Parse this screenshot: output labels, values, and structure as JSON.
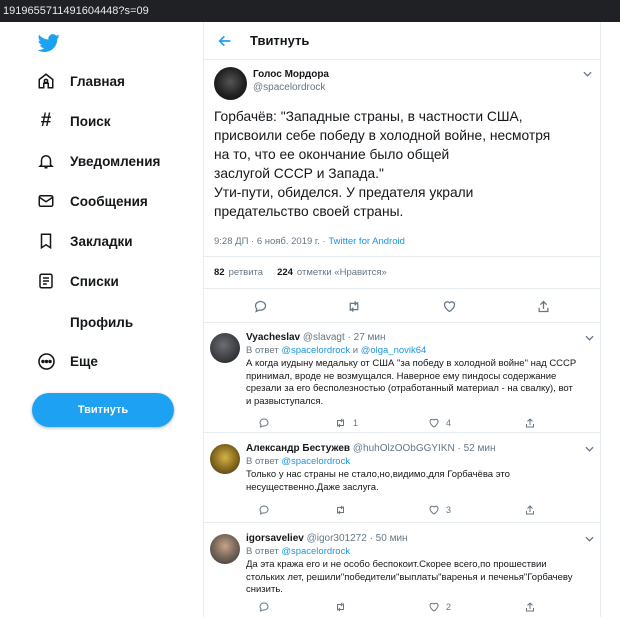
{
  "browser": {
    "url": "1919655711491604448?s=09"
  },
  "sidebar": {
    "items": [
      {
        "label": "Главная",
        "icon": "home-icon"
      },
      {
        "label": "Поиск",
        "icon": "hashtag-icon"
      },
      {
        "label": "Уведомления",
        "icon": "bell-icon"
      },
      {
        "label": "Сообщения",
        "icon": "envelope-icon"
      },
      {
        "label": "Закладки",
        "icon": "bookmark-icon"
      },
      {
        "label": "Списки",
        "icon": "list-icon"
      },
      {
        "label": "Профиль",
        "icon": ""
      },
      {
        "label": "Еще",
        "icon": "more-circle-icon"
      }
    ],
    "tweet_button": "Твитнуть"
  },
  "header": {
    "title": "Твитнуть"
  },
  "tweet": {
    "author": "Голос Мордора",
    "handle": "@spacelordrock",
    "text_lines": [
      "Горбачёв: \"Западные страны, в частности США,",
      "присвоили себе победу в холодной войне, несмотря",
      "на то, что ее окончание было общей",
      "заслугой СССР и Запада.\"",
      "Ути-пути, обиделся. У предателя украли",
      "предательство своей страны."
    ],
    "time": "9:28 ДП · 6 нояб. 2019 г. ·",
    "source": "Twitter for Android",
    "retweets_count": "82",
    "retweets_label": "ретвита",
    "likes_count": "224",
    "likes_label": "отметки «Нравится»"
  },
  "replies": [
    {
      "name": "Vyacheslav",
      "handle": "@slavagt",
      "time": "· 27 мин",
      "reply_prefix": "В ответ",
      "reply_to": "@spacelordrock",
      "reply_and": "и",
      "reply_to2": "@olga_novik64",
      "text_lines": [
        "А когда иудыну медальку от США \"за победу в холодной войне\" над СССР",
        "принимал, вроде не возмущался. Наверное ему пиндосы содержание",
        "срезали за его бесполезностью (отработанный материал - на свалку), вот",
        "и развыступался."
      ],
      "retweets": "1",
      "likes": "4"
    },
    {
      "name": "Александр Бестужев",
      "handle": "@huhOlzOObGGYIKN",
      "time": "· 52 мин",
      "reply_prefix": "В ответ",
      "reply_to": "@spacelordrock",
      "text_lines": [
        "Только у нас страны не стало,но,видимо,для Горбачёва это",
        "несущественно.Даже заслуга."
      ],
      "retweets": "",
      "likes": "3"
    },
    {
      "name": "igorsaveliev",
      "handle": "@igor301272",
      "time": "· 50 мин",
      "reply_prefix": "В ответ",
      "reply_to": "@spacelordrock",
      "text_lines": [
        "Да эта кража его и не особо беспокоит.Скорее всего,по прошествии",
        "стольких лет, решили\"победители\"выплаты\"варенья и печенья\"Горбачеву",
        "снизить."
      ],
      "retweets": "",
      "likes": "2"
    }
  ],
  "colors": {
    "accent": "#1da1f2",
    "link": "#1b95e0",
    "muted": "#657786",
    "text": "#14171a",
    "border": "#e6ecf0"
  }
}
